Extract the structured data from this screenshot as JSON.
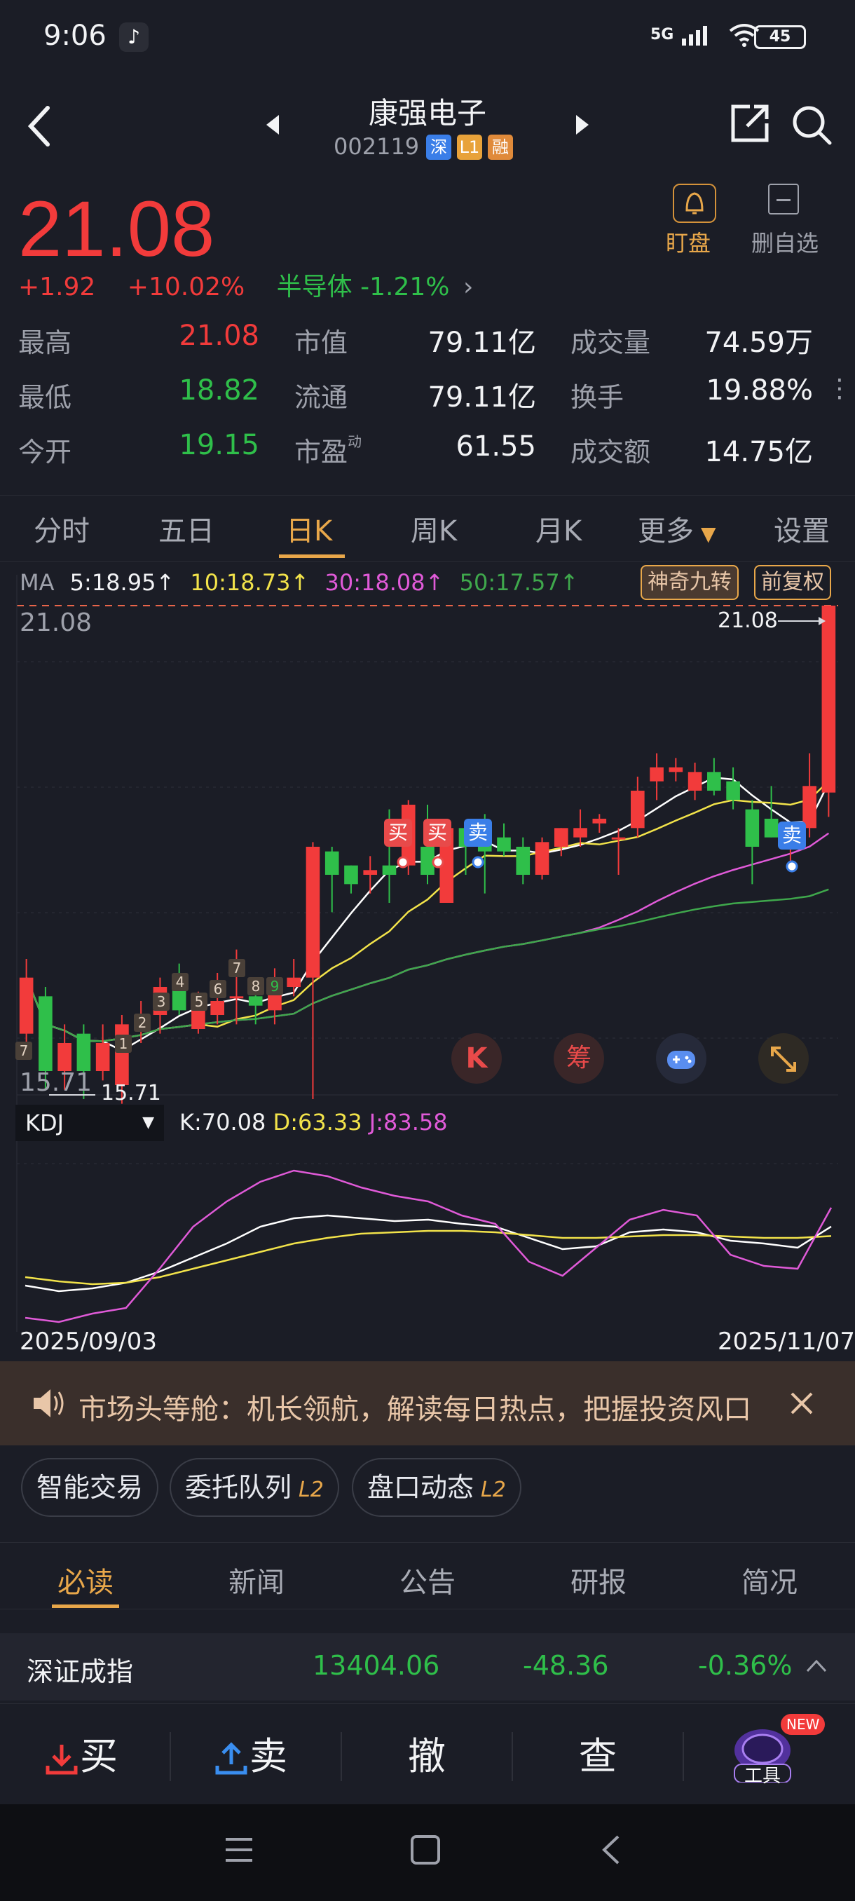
{
  "status_bar": {
    "time": "9:06",
    "signal": "5G",
    "battery": "45"
  },
  "header": {
    "name": "康强电子",
    "code": "002119",
    "tags": [
      "深",
      "L1",
      "融"
    ]
  },
  "quote": {
    "price": "21.08",
    "change": "+1.92",
    "change_pct": "+10.02%",
    "sector": "半导体 -1.21%",
    "watch_label": "盯盘",
    "remove_label": "删自选",
    "rows": [
      [
        {
          "label": "最高",
          "value": "21.08"
        },
        {
          "label": "市值",
          "value": "79.11亿"
        },
        {
          "label": "成交量",
          "value": "74.59万"
        }
      ],
      [
        {
          "label": "最低",
          "value": "18.82"
        },
        {
          "label": "流通",
          "value": "79.11亿"
        },
        {
          "label": "换手",
          "value": "19.88%"
        }
      ],
      [
        {
          "label": "今开",
          "value": "19.15"
        },
        {
          "label": "市盈",
          "value": "61.55"
        },
        {
          "label": "成交额",
          "value": "14.75亿"
        }
      ]
    ],
    "pe_super": "动"
  },
  "kline_tabs": [
    "分时",
    "五日",
    "日K",
    "周K",
    "月K",
    "更多",
    "设置"
  ],
  "ma_legend": {
    "label": "MA",
    "ma5": "5:18.95",
    "ma10": "10:18.73",
    "ma30": "30:18.08",
    "ma50": "50:17.57",
    "btn1": "神奇九转",
    "btn2": "前复权"
  },
  "chart": {
    "high_label": "21.08",
    "low_label": "15.71",
    "last_label": "21.08",
    "signals": [
      "买",
      "买",
      "卖",
      "卖"
    ],
    "tool_icons": [
      "K",
      "筹"
    ],
    "kdj_label": "KDJ",
    "kdj_k": "K:70.08",
    "kdj_d": "D:63.33",
    "kdj_j": "J:83.58",
    "date_start": "2025/09/03",
    "date_end": "2025/11/07",
    "nine_turn_labels": [
      "7",
      "1",
      "2",
      "3",
      "4",
      "5",
      "6",
      "7",
      "8",
      "9",
      "1",
      "7"
    ]
  },
  "chart_data": {
    "type": "candlestick",
    "x_range": [
      "2025/09/03",
      "2025/11/07"
    ],
    "ylim": [
      15.71,
      21.08
    ],
    "candles": [
      {
        "o": 16.5,
        "c": 17.1,
        "h": 17.3,
        "l": 16.3
      },
      {
        "o": 16.9,
        "c": 16.1,
        "h": 17.0,
        "l": 15.9
      },
      {
        "o": 16.1,
        "c": 16.4,
        "h": 16.6,
        "l": 15.9
      },
      {
        "o": 16.5,
        "c": 16.1,
        "h": 16.6,
        "l": 15.8
      },
      {
        "o": 16.1,
        "c": 16.4,
        "h": 16.6,
        "l": 16.0
      },
      {
        "o": 15.95,
        "c": 16.6,
        "h": 16.7,
        "l": 15.75
      },
      {
        "o": 16.55,
        "c": 16.7,
        "h": 16.85,
        "l": 16.4
      },
      {
        "o": 16.7,
        "c": 17.0,
        "h": 17.1,
        "l": 16.5
      },
      {
        "o": 17.1,
        "c": 16.75,
        "h": 17.25,
        "l": 16.7
      },
      {
        "o": 16.55,
        "c": 16.85,
        "h": 16.95,
        "l": 16.5
      },
      {
        "o": 16.7,
        "c": 16.85,
        "h": 17.15,
        "l": 16.6
      },
      {
        "o": 16.9,
        "c": 16.9,
        "h": 17.4,
        "l": 16.6
      },
      {
        "o": 16.9,
        "c": 16.8,
        "h": 17.0,
        "l": 16.6
      },
      {
        "o": 16.75,
        "c": 17.05,
        "h": 17.2,
        "l": 16.6
      },
      {
        "o": 17.0,
        "c": 17.1,
        "h": 17.3,
        "l": 16.9
      },
      {
        "o": 17.1,
        "c": 18.5,
        "h": 18.55,
        "l": 15.8
      },
      {
        "o": 18.45,
        "c": 18.2,
        "h": 18.5,
        "l": 17.8
      },
      {
        "o": 18.3,
        "c": 18.1,
        "h": 18.3,
        "l": 18.0
      },
      {
        "o": 18.2,
        "c": 18.25,
        "h": 18.4,
        "l": 18.0
      },
      {
        "o": 18.3,
        "c": 18.2,
        "h": 18.9,
        "l": 17.9
      },
      {
        "o": 18.3,
        "c": 18.95,
        "h": 19.0,
        "l": 18.2
      },
      {
        "o": 18.5,
        "c": 18.2,
        "h": 18.95,
        "l": 18.1
      },
      {
        "o": 17.9,
        "c": 18.7,
        "h": 18.8,
        "l": 17.9
      },
      {
        "o": 18.7,
        "c": 18.5,
        "h": 18.75,
        "l": 18.2
      },
      {
        "o": 18.6,
        "c": 18.45,
        "h": 18.85,
        "l": 18.0
      },
      {
        "o": 18.6,
        "c": 18.45,
        "h": 18.75,
        "l": 18.4
      },
      {
        "o": 18.5,
        "c": 18.2,
        "h": 18.6,
        "l": 18.1
      },
      {
        "o": 18.2,
        "c": 18.55,
        "h": 18.6,
        "l": 18.15
      },
      {
        "o": 18.5,
        "c": 18.7,
        "h": 18.7,
        "l": 18.4
      },
      {
        "o": 18.6,
        "c": 18.7,
        "h": 18.9,
        "l": 18.5
      },
      {
        "o": 18.75,
        "c": 18.8,
        "h": 18.85,
        "l": 18.65
      },
      {
        "o": 18.6,
        "c": 18.6,
        "h": 18.7,
        "l": 18.2
      },
      {
        "o": 18.7,
        "c": 19.1,
        "h": 19.25,
        "l": 18.6
      },
      {
        "o": 19.2,
        "c": 19.35,
        "h": 19.5,
        "l": 19.0
      },
      {
        "o": 19.3,
        "c": 19.35,
        "h": 19.45,
        "l": 19.2
      },
      {
        "o": 19.1,
        "c": 19.3,
        "h": 19.4,
        "l": 19.0
      },
      {
        "o": 19.3,
        "c": 19.1,
        "h": 19.45,
        "l": 19.05
      },
      {
        "o": 19.2,
        "c": 19.0,
        "h": 19.35,
        "l": 18.9
      },
      {
        "o": 18.9,
        "c": 18.5,
        "h": 19.0,
        "l": 18.1
      },
      {
        "o": 18.8,
        "c": 18.6,
        "h": 19.15,
        "l": 18.6
      },
      {
        "o": 18.5,
        "c": 18.6,
        "h": 18.75,
        "l": 18.35
      },
      {
        "o": 18.7,
        "c": 19.15,
        "h": 19.5,
        "l": 18.6
      },
      {
        "o": 19.08,
        "c": 21.08,
        "h": 21.08,
        "l": 18.82
      }
    ],
    "kdj": {
      "k": [
        28,
        24,
        26,
        30,
        38,
        48,
        58,
        70,
        76,
        78,
        76,
        74,
        75,
        72,
        70,
        62,
        54,
        56,
        66,
        68,
        66,
        60,
        58,
        55,
        70.08
      ],
      "d": [
        34,
        31,
        29,
        30,
        34,
        40,
        46,
        52,
        58,
        62,
        65,
        66,
        67,
        67,
        66,
        64,
        62,
        62,
        63,
        64,
        64,
        63,
        62,
        62,
        63.33
      ],
      "j": [
        5,
        2,
        8,
        12,
        40,
        70,
        88,
        102,
        110,
        106,
        98,
        92,
        88,
        78,
        72,
        45,
        35,
        55,
        75,
        82,
        78,
        50,
        42,
        40,
        83.58
      ]
    }
  },
  "banner": {
    "text": "市场头等舱：机长领航，解读每日热点，把握投资风口"
  },
  "pills": [
    {
      "label": "智能交易",
      "badge": ""
    },
    {
      "label": "委托队列",
      "badge": "L2"
    },
    {
      "label": "盘口动态",
      "badge": "L2"
    }
  ],
  "info_tabs": [
    "必读",
    "新闻",
    "公告",
    "研报",
    "简况"
  ],
  "index_row": {
    "name": "深证成指",
    "value": "13404.06",
    "change": "-48.36",
    "pct": "-0.36%"
  },
  "bottom_bar": {
    "buy": "买",
    "sell": "卖",
    "cancel": "撤",
    "query": "查",
    "tools": "工具",
    "new_badge": "NEW"
  },
  "colors": {
    "up": "#f23b3b",
    "down": "#2fbf4a",
    "accent": "#e8a74a",
    "ma5": "#ffffff",
    "ma10": "#f2e34a",
    "ma30": "#e05ad8",
    "ma50": "#3fa84c"
  }
}
